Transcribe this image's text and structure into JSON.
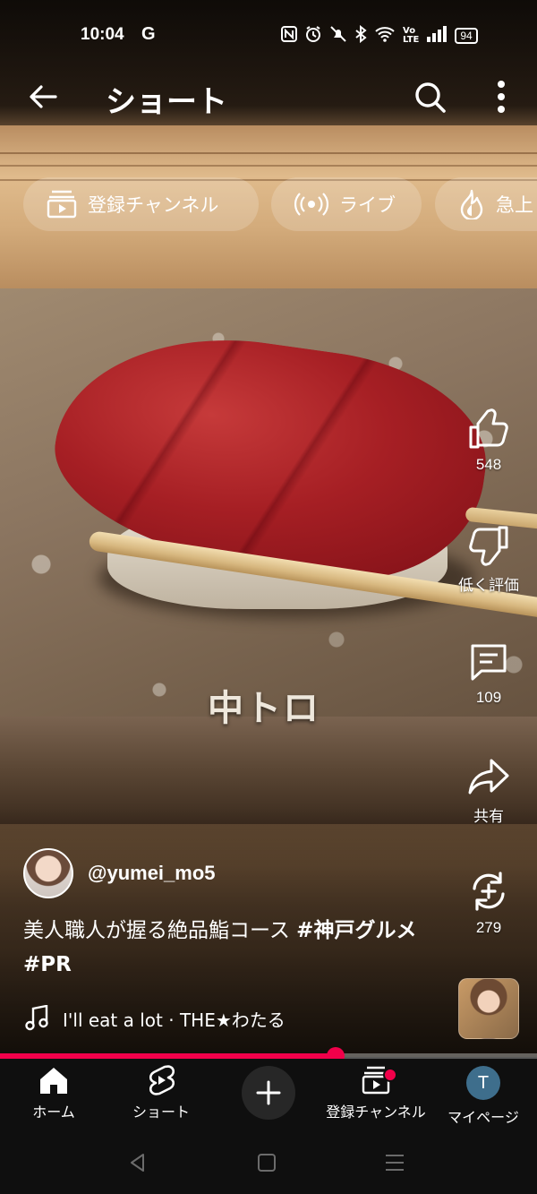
{
  "status_bar": {
    "time": "10:04",
    "g": "G",
    "battery": "94"
  },
  "header": {
    "title": "ショート"
  },
  "chips": [
    {
      "label": "登録チャンネル",
      "icon": "subscriptions-icon"
    },
    {
      "label": "ライブ",
      "icon": "live-icon"
    },
    {
      "label": "急上",
      "icon": "trending-icon"
    }
  ],
  "video": {
    "overlay_text": "中トロ"
  },
  "actions": {
    "like_count": "548",
    "dislike_label": "低く評価",
    "comment_count": "109",
    "share_label": "共有",
    "remix_count": "279"
  },
  "meta": {
    "channel": "@yumei_mo5",
    "caption_text": "美人職人が握る絶品鮨コース ",
    "caption_tags": "#神戸グルメ #PR",
    "music": "I'll eat a lot · THE★わたる"
  },
  "progress": {
    "fraction": 0.625
  },
  "bottom_nav": {
    "home": "ホーム",
    "shorts": "ショート",
    "subscriptions": "登録チャンネル",
    "mypage": "マイページ",
    "avatar_letter": "T"
  },
  "colors": {
    "accent": "#f1004a",
    "nav_bg": "#0f0f0f",
    "avatar_bg": "#3e6e8c"
  }
}
